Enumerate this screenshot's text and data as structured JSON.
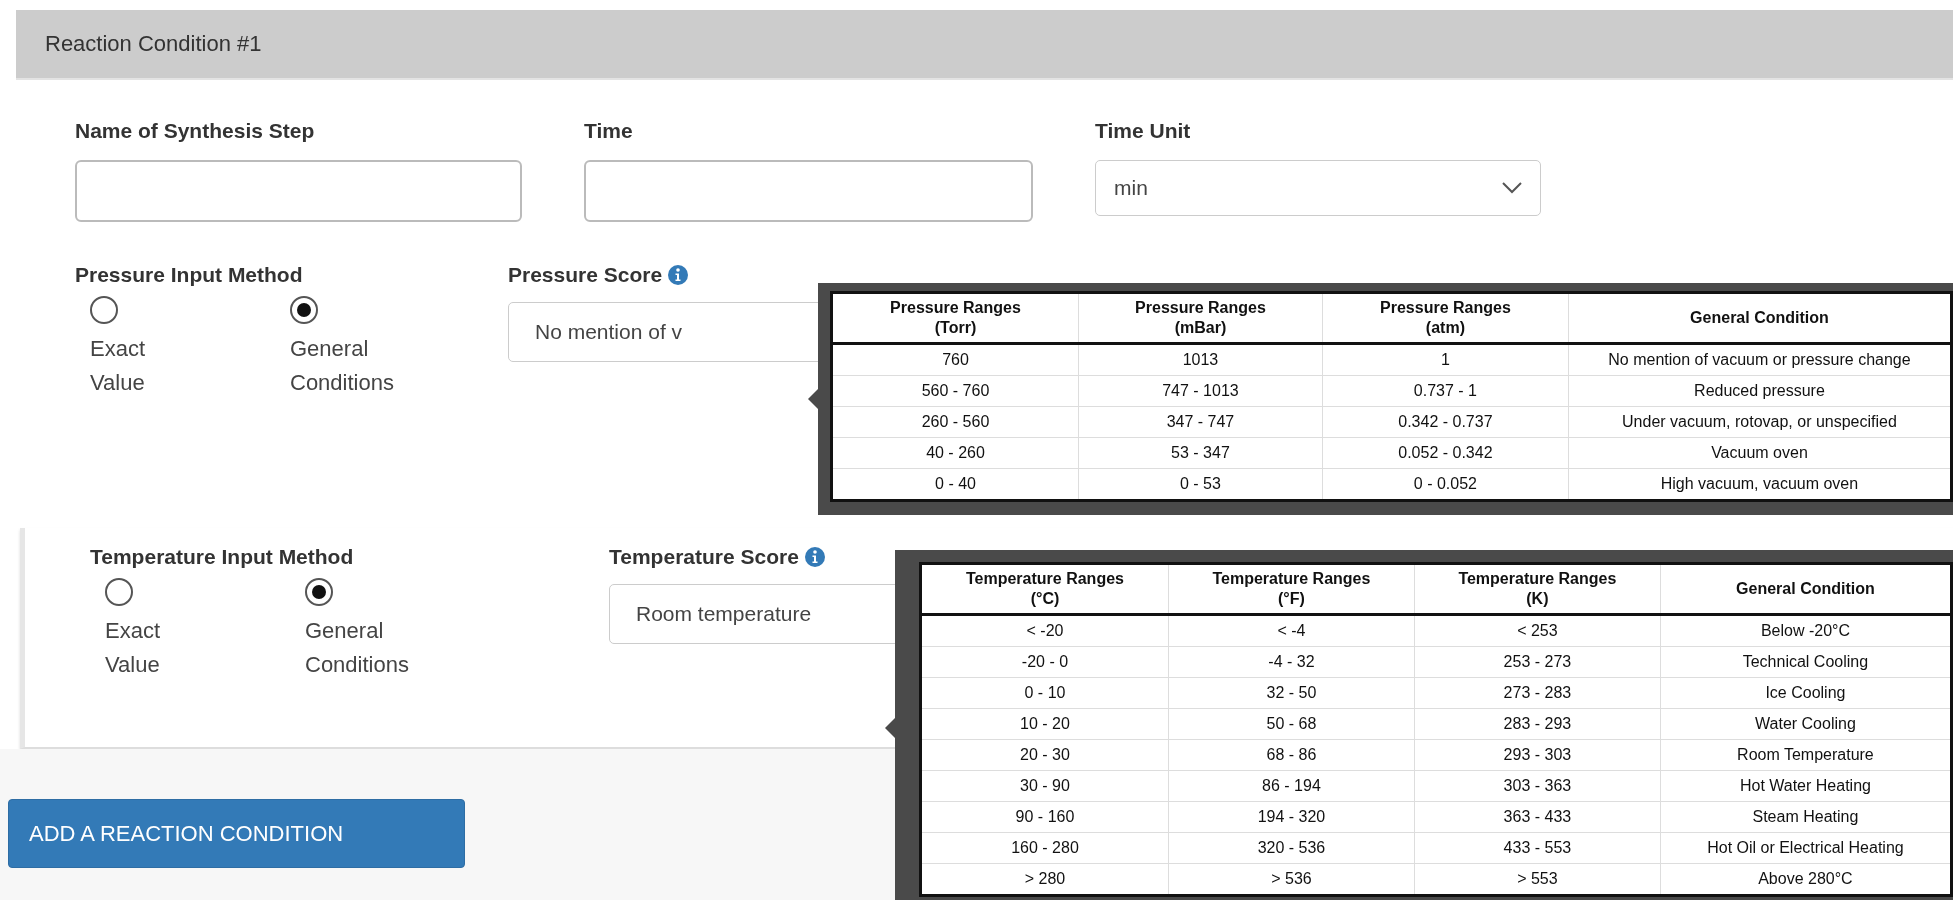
{
  "header": {
    "title": "Reaction Condition #1"
  },
  "fields": [
    {
      "label": "Name of Synthesis Step",
      "kind": "text"
    },
    {
      "label": "Time",
      "kind": "text"
    },
    {
      "label": "Time Unit",
      "kind": "select",
      "value": "min"
    }
  ],
  "pressure": {
    "method_label": "Pressure Input Method",
    "options": [
      {
        "lines": [
          "Exact",
          "Value"
        ],
        "selected": false
      },
      {
        "lines": [
          "General",
          "Conditions"
        ],
        "selected": true
      }
    ],
    "score_label": "Pressure Score",
    "score_value": "No mention of v",
    "tooltip": {
      "columns": [
        "Pressure Ranges (Torr)",
        "Pressure Ranges (mBar)",
        "Pressure Ranges (atm)",
        "General Condition"
      ],
      "rows": [
        [
          "760",
          "1013",
          "1",
          "No mention of vacuum or pressure change"
        ],
        [
          "560 - 760",
          "747 - 1013",
          "0.737 - 1",
          "Reduced pressure"
        ],
        [
          "260 - 560",
          "347 - 747",
          "0.342 - 0.737",
          "Under vacuum, rotovap, or unspecified"
        ],
        [
          "40 - 260",
          "53 - 347",
          "0.052 - 0.342",
          "Vacuum oven"
        ],
        [
          "0 - 40",
          "0 - 53",
          "0 - 0.052",
          "High vacuum, vacuum oven"
        ]
      ]
    }
  },
  "temperature": {
    "method_label": "Temperature Input Method",
    "options": [
      {
        "lines": [
          "Exact",
          "Value"
        ],
        "selected": false
      },
      {
        "lines": [
          "General",
          "Conditions"
        ],
        "selected": true
      }
    ],
    "score_label": "Temperature Score",
    "score_value": "Room temperature",
    "tooltip": {
      "columns": [
        "Temperature Ranges (°C)",
        "Temperature Ranges (°F)",
        "Temperature Ranges (K)",
        "General Condition"
      ],
      "rows": [
        [
          "< -20",
          "< -4",
          "< 253",
          "Below -20°C"
        ],
        [
          "-20 - 0",
          "-4 - 32",
          "253 - 273",
          "Technical Cooling"
        ],
        [
          "0 - 10",
          "32 - 50",
          "273 - 283",
          "Ice Cooling"
        ],
        [
          "10 - 20",
          "50 - 68",
          "283 - 293",
          "Water Cooling"
        ],
        [
          "20 - 30",
          "68 - 86",
          "293 - 303",
          "Room Temperature"
        ],
        [
          "30 - 90",
          "86 - 194",
          "303 - 363",
          "Hot Water Heating"
        ],
        [
          "90 - 160",
          "194 - 320",
          "363 - 433",
          "Steam Heating"
        ],
        [
          "160 - 280",
          "320 - 536",
          "433 - 553",
          "Hot Oil or Electrical Heating"
        ],
        [
          "> 280",
          "> 536",
          "> 553",
          "Above 280°C"
        ]
      ]
    }
  },
  "add_button": "ADD A REACTION CONDITION"
}
